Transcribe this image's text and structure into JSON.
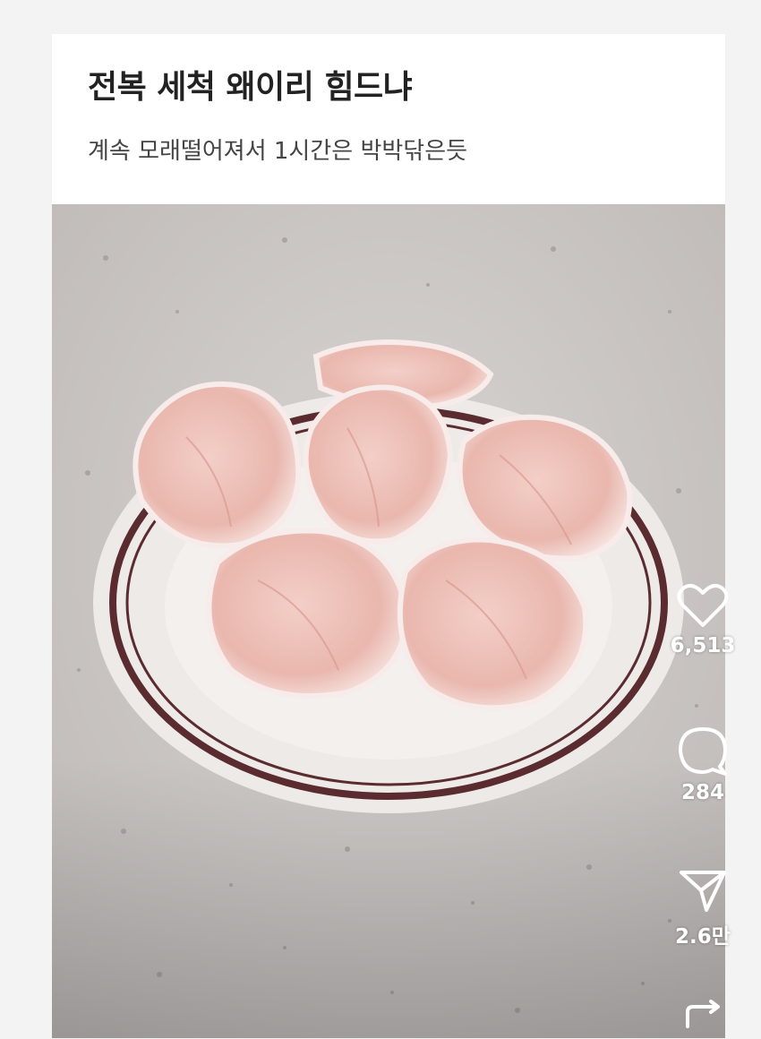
{
  "post": {
    "title": "전복 세척 왜이리 힘드냐",
    "subtitle": "계속 모래떨어져서 1시간은 박박닦은듯"
  },
  "image": {
    "subject": "abalone-on-plate-photo"
  },
  "actions": {
    "like": {
      "icon": "heart-icon",
      "count": "6,513"
    },
    "comment": {
      "icon": "comment-icon",
      "count": "284"
    },
    "share": {
      "icon": "send-icon",
      "count": "2.6만"
    },
    "repost": {
      "icon": "repost-icon"
    }
  },
  "colors": {
    "plate_rim": "#5a2b2f",
    "counter": "#cfcac8",
    "abalone": "#efc2ba",
    "icon": "#ffffff"
  }
}
